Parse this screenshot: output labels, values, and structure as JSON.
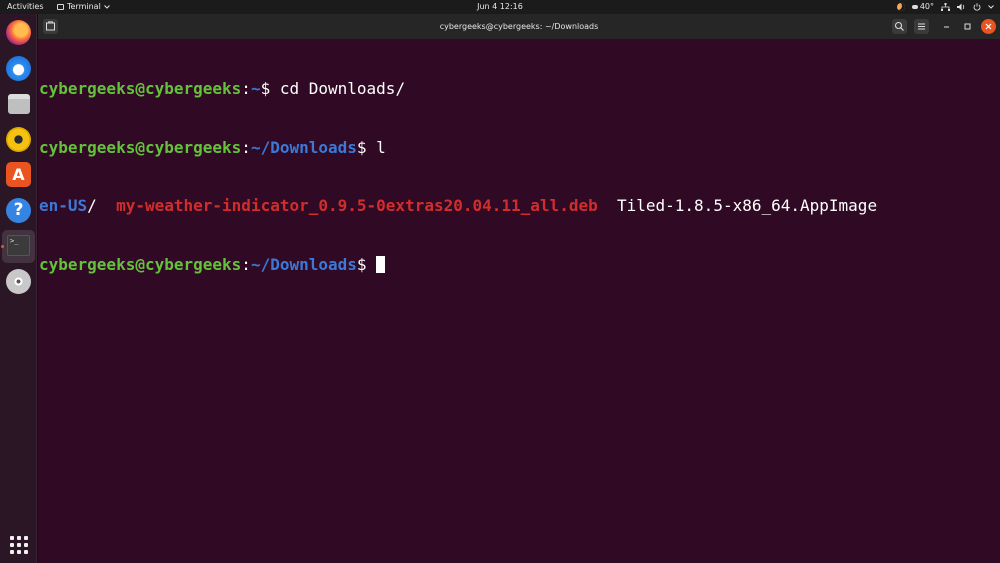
{
  "topbar": {
    "activities": "Activities",
    "app_menu": "Terminal",
    "clock": "Jun 4  12:16",
    "temperature": "40°"
  },
  "dock": {
    "items": [
      "firefox-icon",
      "thunderbird-icon",
      "files-icon",
      "rhythmbox-icon",
      "app-center-icon",
      "help-icon",
      "terminal-icon",
      "dvd-icon"
    ],
    "appcenter_glyph": "A",
    "help_glyph": "?",
    "terminal_glyph": ">_"
  },
  "window": {
    "title": "cybergeeks@cybergeeks: ~/Downloads"
  },
  "terminal": {
    "user": "cybergeeks@cybergeeks",
    "colon": ":",
    "line1": {
      "path": "~",
      "prompt": "$ ",
      "command": "cd Downloads/"
    },
    "line2": {
      "path": "~/Downloads",
      "prompt": "$ ",
      "command": "l"
    },
    "listing": {
      "dir": "en-US",
      "dir_suffix": "/  ",
      "deb": "my-weather-indicator_0.9.5-0extras20.04.11_all.deb",
      "gap": "  ",
      "appimage": "Tiled-1.8.5-x86_64.AppImage"
    },
    "line4": {
      "path": "~/Downloads",
      "prompt": "$ "
    }
  },
  "colors": {
    "terminal_bg": "#300a24",
    "user_green": "#64c23a",
    "path_blue": "#3b78d8",
    "deb_red": "#d12d2d",
    "accent_orange": "#e95420"
  }
}
